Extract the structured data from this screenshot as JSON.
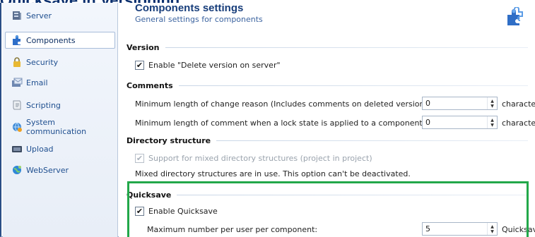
{
  "doc_title": "Quicksave in Versioning",
  "sidebar": {
    "items": [
      {
        "label": "Server",
        "icon": "server-icon"
      },
      {
        "label": "Components",
        "icon": "components-icon"
      },
      {
        "label": "Security",
        "icon": "lock-icon"
      },
      {
        "label": "Email",
        "icon": "email-icon"
      },
      {
        "label": "Scripting",
        "icon": "script-icon"
      },
      {
        "label": "System communication",
        "icon": "system-communication-icon"
      },
      {
        "label": "Upload",
        "icon": "upload-icon"
      },
      {
        "label": "WebServer",
        "icon": "webserver-icon"
      }
    ],
    "active_index": 1
  },
  "panel": {
    "title": "Components settings",
    "subtitle": "General settings for components",
    "icon": "puzzle-icon"
  },
  "version": {
    "heading": "Version",
    "enable_delete_label": "Enable \"Delete version on server\"",
    "enable_delete_checked": true
  },
  "comments": {
    "heading": "Comments",
    "min_change_reason_label": "Minimum length of change reason (Includes comments on deleted versions):",
    "min_change_reason_value": "0",
    "min_change_reason_unit": "characters",
    "min_lock_comment_label": "Minimum length of comment when a lock state is applied to a component:",
    "min_lock_comment_value": "0",
    "min_lock_comment_unit": "characters"
  },
  "directory": {
    "heading": "Directory structure",
    "mixed_label": "Support for mixed directory structures (project in project)",
    "mixed_checked": true,
    "mixed_disabled": true,
    "note": "Mixed directory structures are in use. This option can't be deactivated."
  },
  "quicksave": {
    "heading": "Quicksave",
    "enable_label": "Enable Quicksave",
    "enable_checked": true,
    "max_label": "Maximum number per user per component:",
    "max_value": "5",
    "max_unit": "Quicksave"
  },
  "colors": {
    "highlight": "#22a84a",
    "title": "#173d7a",
    "doc_title": "#0a2f6e"
  }
}
